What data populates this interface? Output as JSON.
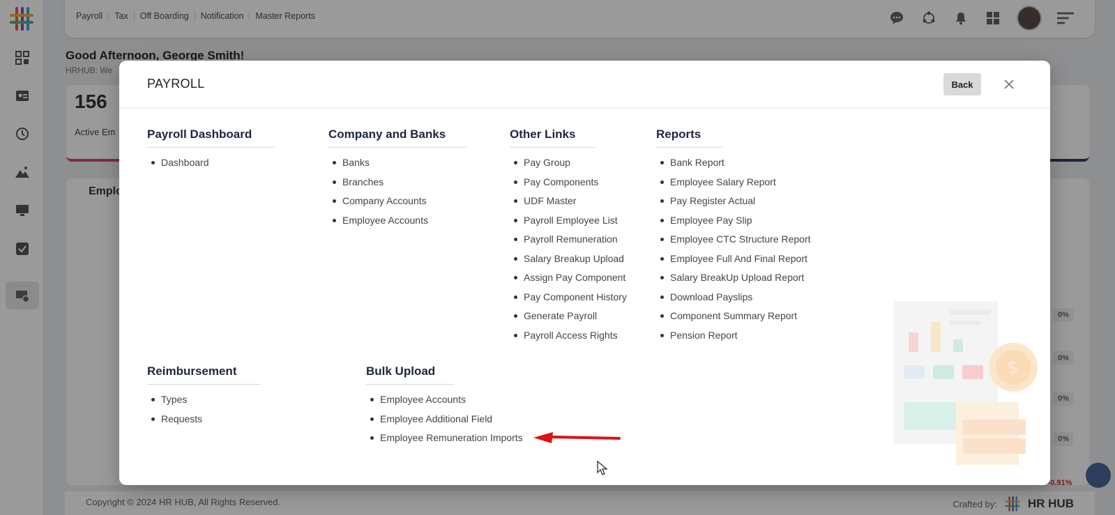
{
  "app": {
    "topnav": [
      "Payroll",
      "Tax",
      "Off Boarding",
      "Notification",
      "Master Reports"
    ],
    "greeting": "Good Afternoon, George Smith!",
    "sub_greeting": "HRHUB: We",
    "stat_value": "156",
    "stat_label": "Active Em",
    "emp_card_title": "Emplo",
    "percentages": [
      "0%",
      "0%",
      "0%",
      "0%",
      "-0.91%"
    ],
    "footer_copyright": "Copyright © 2024 HR HUB, All Rights Reserved.",
    "footer_crafted_label": "Crafted by:",
    "footer_brand": "HR HUB"
  },
  "modal": {
    "title": "PAYROLL",
    "back_label": "Back",
    "sections": [
      {
        "heading": "Payroll Dashboard",
        "items": [
          "Dashboard"
        ]
      },
      {
        "heading": "Company and Banks",
        "items": [
          "Banks",
          "Branches",
          "Company Accounts",
          "Employee Accounts"
        ]
      },
      {
        "heading": "Other Links",
        "items": [
          "Pay Group",
          "Pay Components",
          "UDF Master",
          "Payroll Employee List",
          "Payroll Remuneration",
          "Salary Breakup Upload",
          "Assign Pay Component",
          "Pay Component History",
          "Generate Payroll",
          "Payroll Access Rights"
        ]
      },
      {
        "heading": "Reports",
        "items": [
          "Bank Report",
          "Employee Salary Report",
          "Pay Register Actual",
          "Employee Pay Slip",
          "Employee CTC Structure Report",
          "Employee Full And Final Report",
          "Salary BreakUp Upload Report",
          "Download Payslips",
          "Component Summary Report",
          "Pension Report"
        ]
      },
      {
        "heading": "Reimbursement",
        "items": [
          "Types",
          "Requests"
        ]
      },
      {
        "heading": "Bulk Upload",
        "items": [
          "Employee Accounts",
          "Employee Additional Field",
          "Employee Remuneration Imports"
        ]
      }
    ]
  },
  "colors": {
    "accent_red": "#e01010",
    "heading": "#1e2540",
    "stat_border": "#d6335a"
  }
}
